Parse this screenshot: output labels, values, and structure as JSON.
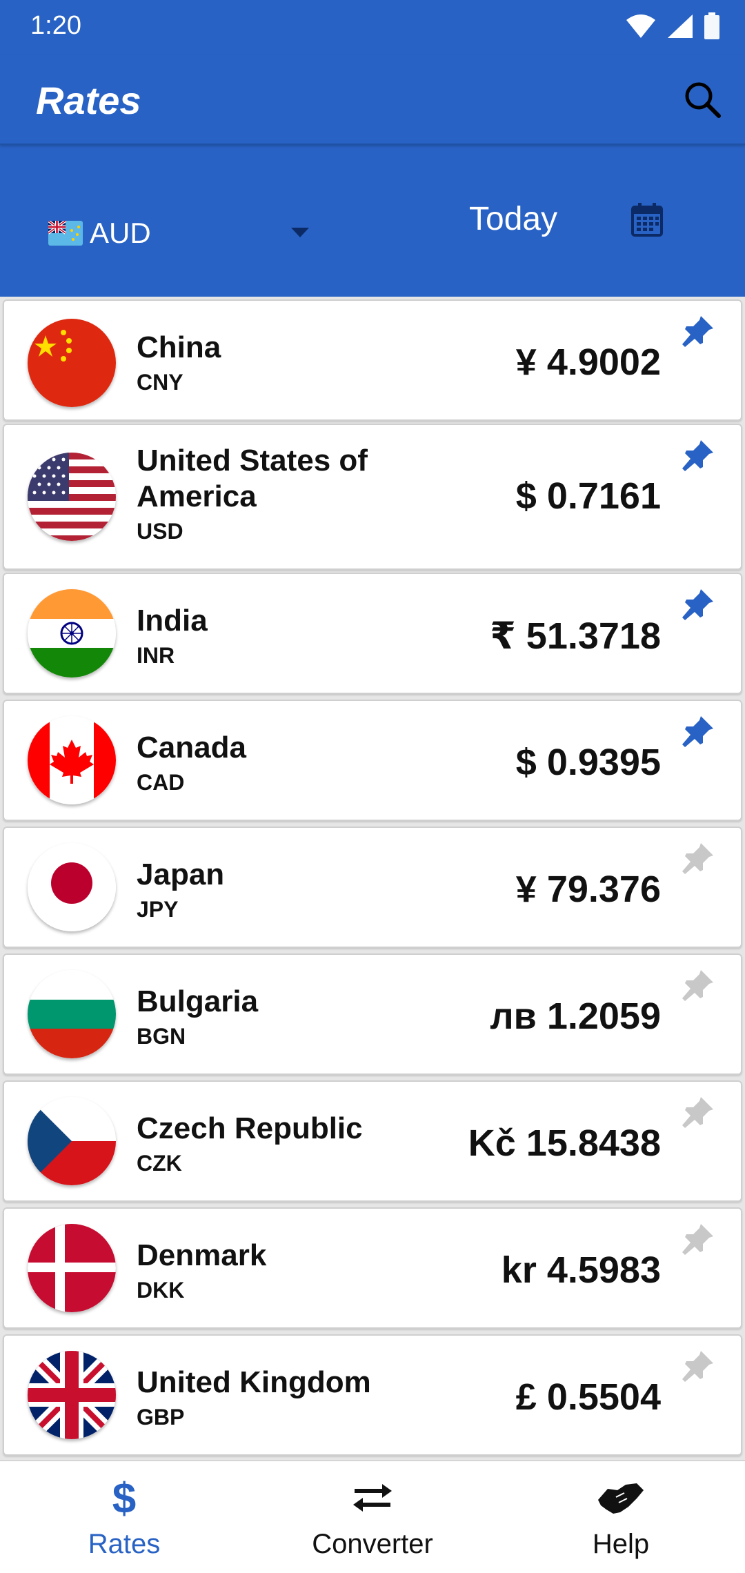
{
  "status_bar": {
    "time": "1:20"
  },
  "toolbar": {
    "title": "Rates",
    "search_icon": "search-icon"
  },
  "selector": {
    "base_currency": "AUD",
    "base_flag": "tuvalu-australia-flag",
    "date": "Today",
    "calendar_icon": "calendar-icon"
  },
  "rates": [
    {
      "country": "China",
      "code": "CNY",
      "rate": "¥ 4.9002",
      "pinned": true
    },
    {
      "country": "United States of America",
      "code": "USD",
      "rate": "$ 0.7161",
      "pinned": true
    },
    {
      "country": "India",
      "code": "INR",
      "rate": "₹ 51.3718",
      "pinned": true
    },
    {
      "country": "Canada",
      "code": "CAD",
      "rate": "$ 0.9395",
      "pinned": true
    },
    {
      "country": "Japan",
      "code": "JPY",
      "rate": "¥ 79.376",
      "pinned": false
    },
    {
      "country": "Bulgaria",
      "code": "BGN",
      "rate": "лв 1.2059",
      "pinned": false
    },
    {
      "country": "Czech Republic",
      "code": "CZK",
      "rate": "Kč 15.8438",
      "pinned": false
    },
    {
      "country": "Denmark",
      "code": "DKK",
      "rate": "kr 4.5983",
      "pinned": false
    },
    {
      "country": "United Kingdom",
      "code": "GBP",
      "rate": "£ 0.5504",
      "pinned": false
    }
  ],
  "bottom_nav": {
    "items": [
      {
        "label": "Rates",
        "icon": "dollar-icon",
        "active": true
      },
      {
        "label": "Converter",
        "icon": "swap-arrows-icon",
        "active": false
      },
      {
        "label": "Help",
        "icon": "handshake-icon",
        "active": false
      }
    ]
  },
  "colors": {
    "primary": "#2862c4",
    "pin_active": "#2862c4",
    "pin_inactive": "#c8c8c8"
  }
}
